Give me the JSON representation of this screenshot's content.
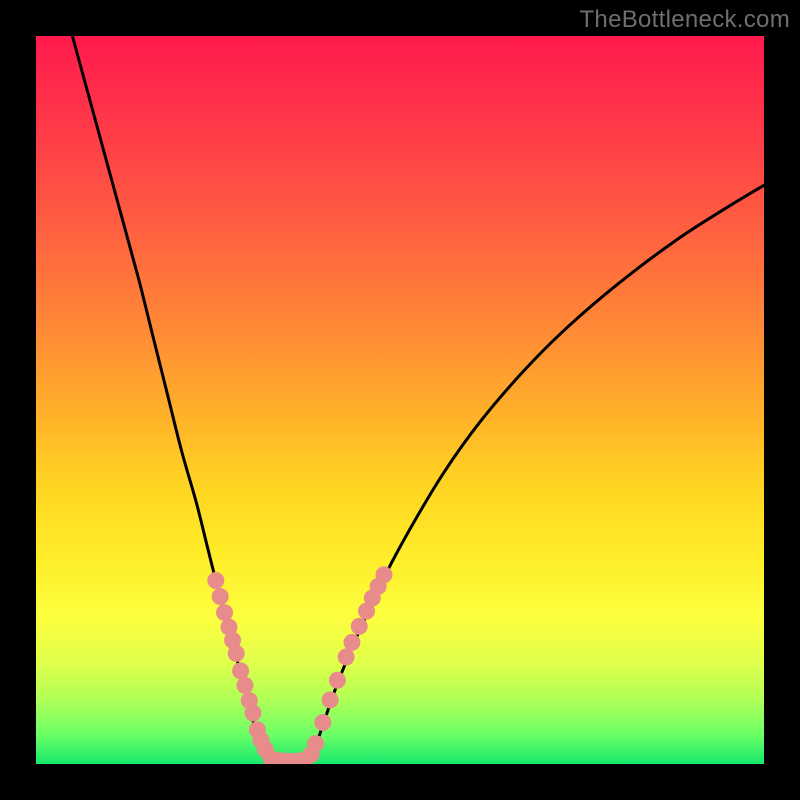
{
  "watermark": "TheBottleneck.com",
  "colors": {
    "frame": "#000000",
    "curve": "#000000",
    "dot_fill": "#e78b8b",
    "dot_stroke": "#d46f6f"
  },
  "chart_data": {
    "type": "line",
    "title": "",
    "xlabel": "",
    "ylabel": "",
    "xlim": [
      0,
      100
    ],
    "ylim": [
      0,
      100
    ],
    "note": "No numeric axes shown; values are normalized 0–100 coordinates where y=0 is top and y=100 is bottom of the plot area.",
    "series": [
      {
        "name": "left-curve",
        "x": [
          5,
          8,
          11,
          14,
          16,
          18,
          20,
          22,
          23.5,
          25,
          26.3,
          27.4,
          28.3,
          29,
          29.6,
          30.2,
          30.8,
          31.4,
          32,
          32.5
        ],
        "y": [
          0,
          11,
          22,
          33,
          41,
          49,
          57,
          64,
          70,
          76,
          81,
          85,
          88,
          91,
          93.3,
          95.4,
          97.2,
          98.5,
          99.4,
          100
        ]
      },
      {
        "name": "floor-curve",
        "x": [
          32.5,
          33.5,
          34.5,
          35.5,
          36.5,
          37.5
        ],
        "y": [
          100,
          100,
          100,
          100,
          100,
          100
        ]
      },
      {
        "name": "right-curve",
        "x": [
          37.5,
          38.6,
          39.8,
          41.2,
          43,
          45.2,
          48,
          51.5,
          56,
          61,
          67,
          73,
          80,
          88,
          95,
          100
        ],
        "y": [
          100,
          97,
          93.5,
          89.5,
          85,
          80,
          74,
          67.5,
          60,
          53,
          46,
          40,
          34,
          28,
          23.5,
          20.5
        ]
      }
    ],
    "scatter": {
      "name": "dots",
      "points": [
        {
          "x": 24.7,
          "y": 74.8
        },
        {
          "x": 25.3,
          "y": 77.0
        },
        {
          "x": 25.9,
          "y": 79.2
        },
        {
          "x": 26.5,
          "y": 81.2
        },
        {
          "x": 27.0,
          "y": 83.0
        },
        {
          "x": 27.5,
          "y": 84.8
        },
        {
          "x": 28.1,
          "y": 87.2
        },
        {
          "x": 28.7,
          "y": 89.2
        },
        {
          "x": 29.3,
          "y": 91.3
        },
        {
          "x": 29.8,
          "y": 93.0
        },
        {
          "x": 30.4,
          "y": 95.3
        },
        {
          "x": 30.9,
          "y": 96.7
        },
        {
          "x": 31.5,
          "y": 98.0
        },
        {
          "x": 32.3,
          "y": 99.3
        },
        {
          "x": 33.3,
          "y": 99.5
        },
        {
          "x": 34.5,
          "y": 99.6
        },
        {
          "x": 35.6,
          "y": 99.6
        },
        {
          "x": 36.7,
          "y": 99.5
        },
        {
          "x": 37.8,
          "y": 98.7
        },
        {
          "x": 38.4,
          "y": 97.2
        },
        {
          "x": 39.4,
          "y": 94.3
        },
        {
          "x": 40.4,
          "y": 91.2
        },
        {
          "x": 41.4,
          "y": 88.5
        },
        {
          "x": 42.6,
          "y": 85.3
        },
        {
          "x": 43.4,
          "y": 83.3
        },
        {
          "x": 44.4,
          "y": 81.1
        },
        {
          "x": 45.4,
          "y": 79.0
        },
        {
          "x": 46.2,
          "y": 77.2
        },
        {
          "x": 47.0,
          "y": 75.6
        },
        {
          "x": 47.8,
          "y": 74.0
        }
      ]
    }
  }
}
